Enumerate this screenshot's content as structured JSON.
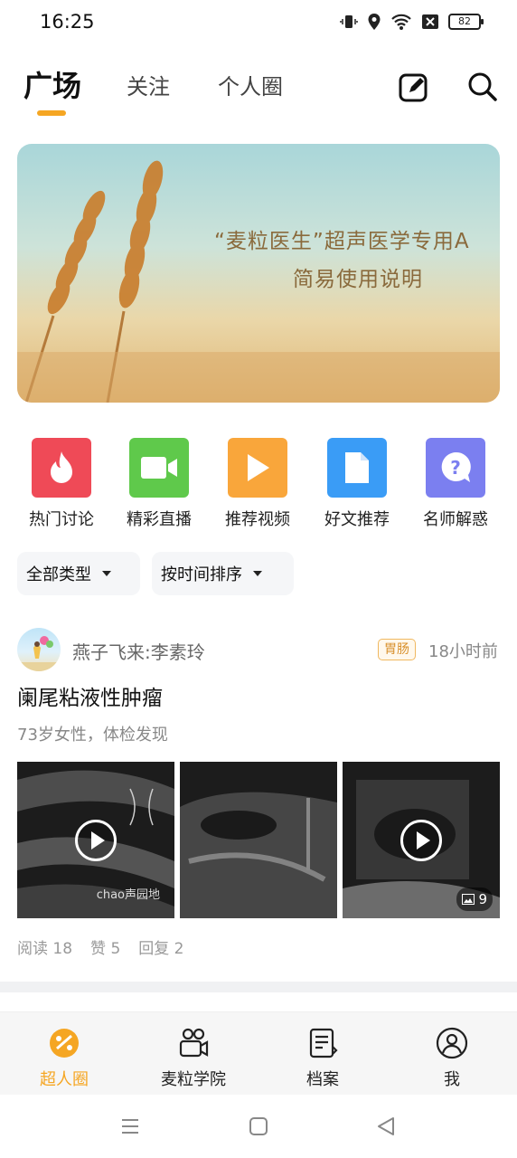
{
  "status_bar": {
    "time": "16:25",
    "battery": "82"
  },
  "top_nav": {
    "tabs": [
      {
        "label": "广场",
        "active": true
      },
      {
        "label": "关注",
        "active": false
      },
      {
        "label": "个人圈",
        "active": false
      }
    ],
    "accent": "#f5a623"
  },
  "banner": {
    "line1": "“麦粒医生”超声医学专用A",
    "line2": "简易使用说明"
  },
  "entries": [
    {
      "label": "热门讨论",
      "icon": "flame-icon",
      "color": "#ef4a57"
    },
    {
      "label": "精彩直播",
      "icon": "video-camera-icon",
      "color": "#5fc94b"
    },
    {
      "label": "推荐视频",
      "icon": "play-icon",
      "color": "#f9a63b"
    },
    {
      "label": "好文推荐",
      "icon": "document-icon",
      "color": "#3a9cf6"
    },
    {
      "label": "名师解惑",
      "icon": "question-icon",
      "color": "#7b7ff0"
    }
  ],
  "filters": {
    "type": "全部类型",
    "sort": "按时间排序"
  },
  "post": {
    "author": "燕子飞来:李素玲",
    "tag": "胃肠",
    "time": "18小时前",
    "title": "阑尾粘液性肿瘤",
    "subtitle": "73岁女性，体检发现",
    "thumbnails": [
      {
        "type": "video",
        "watermark": "chao声园地"
      },
      {
        "type": "image"
      },
      {
        "type": "video",
        "count": "9"
      }
    ],
    "stats": {
      "reads": "阅读 18",
      "likes": "赞 5",
      "replies": "回复 2"
    }
  },
  "bottom_nav": {
    "items": [
      {
        "label": "超人圈",
        "icon": "superman-circle-icon",
        "active": true
      },
      {
        "label": "麦粒学院",
        "icon": "academy-icon",
        "active": false
      },
      {
        "label": "档案",
        "icon": "archive-icon",
        "active": false
      },
      {
        "label": "我",
        "icon": "profile-icon",
        "active": false
      }
    ]
  }
}
